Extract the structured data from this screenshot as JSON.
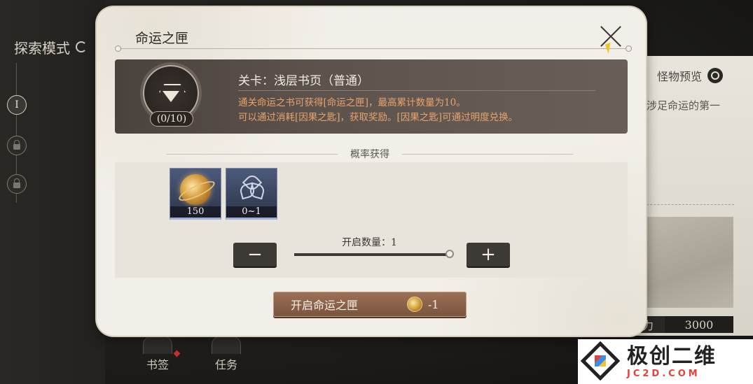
{
  "background": {
    "explore_mode": "探索模式",
    "chapter_active": "I",
    "monster_preview": "怪物预览",
    "desc_fragment": "是涉足命运的第一",
    "power_label": "力",
    "power_value": "3000",
    "bottom_buttons": [
      "书签",
      "任务"
    ]
  },
  "modal": {
    "title": "命运之匣",
    "stage": {
      "name": "关卡：浅层书页（普通）",
      "count": "(0/10)",
      "desc_line1": "通关命运之书可获得[命运之匣]，最高累计数量为10。",
      "desc_line2": "可以通过消耗[因果之匙]，获取奖励。[因果之匙]可通过明度兑换。"
    },
    "probability_header": "概率获得",
    "rewards": [
      {
        "icon": "golden-orb-icon",
        "amount": "150"
      },
      {
        "icon": "triquetra-knot-icon",
        "amount": "0~1"
      }
    ],
    "quantity_label": "开启数量：1",
    "minus": "−",
    "plus": "+",
    "open_button": "开启命运之匣",
    "open_cost": "-1"
  },
  "watermark": {
    "cn": "极创二维",
    "en": "JC2D.COM"
  }
}
